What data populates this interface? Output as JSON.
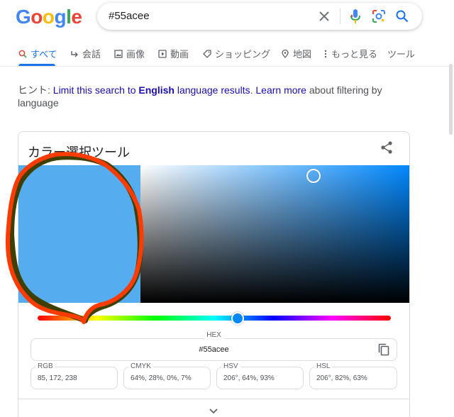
{
  "search": {
    "query": "#55acee"
  },
  "tabs": [
    {
      "label": "すべて",
      "active": true
    },
    {
      "label": "会話"
    },
    {
      "label": "画像"
    },
    {
      "label": "動画"
    },
    {
      "label": "ショッピング"
    },
    {
      "label": "地図"
    },
    {
      "label": "もっと見る"
    },
    {
      "label": "ツール"
    }
  ],
  "hint": {
    "prefix": "ヒント: ",
    "link1_a": "Limit this search to ",
    "link1_bold": "English",
    "link1_b": " language results",
    "sep": ". ",
    "link2": "Learn more",
    "suffix": " about filtering by language"
  },
  "picker": {
    "title": "カラー選択ツール",
    "color": "#55acee",
    "hue_color": "#0088ff",
    "hue_position": 0.57,
    "hex_label": "HEX",
    "hex_value": "#55acee",
    "rgb_label": "RGB",
    "rgb_value": "85, 172, 238",
    "cmyk_label": "CMYK",
    "cmyk_value": "64%, 28%, 0%, 7%",
    "hsv_label": "HSV",
    "hsv_value": "206°, 64%, 93%",
    "hsl_label": "HSL",
    "hsl_value": "206°, 82%, 63%"
  },
  "colors": {
    "accent": "#1a73e8",
    "link": "#1a0dab",
    "annotation_red": "#ff3b00",
    "annotation_dark": "#3f3f00"
  }
}
